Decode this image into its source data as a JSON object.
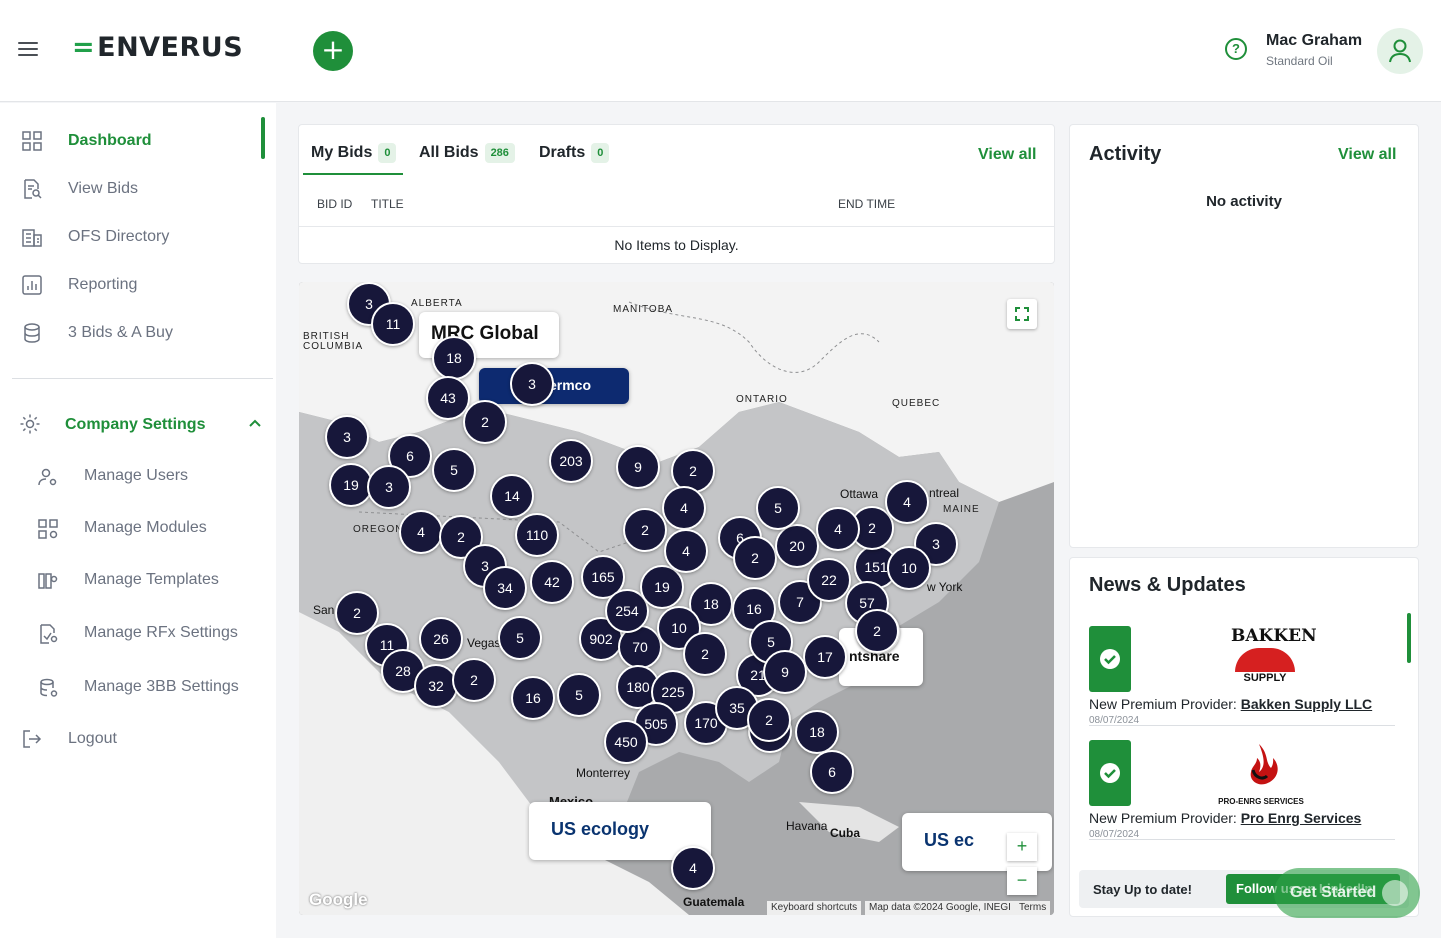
{
  "header": {
    "brand": "ENVERUS",
    "brand_mark": "=",
    "add_label": "+",
    "help_label": "?",
    "user_name": "Mac Graham",
    "user_org": "Standard Oil"
  },
  "sidebar": {
    "items": [
      {
        "label": "Dashboard",
        "icon": "grid-icon"
      },
      {
        "label": "View Bids",
        "icon": "document-search-icon"
      },
      {
        "label": "OFS Directory",
        "icon": "building-icon"
      },
      {
        "label": "Reporting",
        "icon": "bar-chart-icon"
      },
      {
        "label": "3 Bids & A Buy",
        "icon": "database-icon"
      }
    ],
    "company_settings": {
      "label": "Company Settings",
      "items": [
        {
          "label": "Manage Users"
        },
        {
          "label": "Manage Modules"
        },
        {
          "label": "Manage Templates"
        },
        {
          "label": "Manage RFx Settings"
        },
        {
          "label": "Manage 3BB Settings"
        }
      ]
    },
    "logout": "Logout"
  },
  "bids": {
    "tabs": [
      {
        "label": "My Bids",
        "count": "0"
      },
      {
        "label": "All Bids",
        "count": "286"
      },
      {
        "label": "Drafts",
        "count": "0"
      }
    ],
    "view_all": "View all",
    "columns": [
      "BID ID",
      "TITLE",
      "END TIME"
    ],
    "empty": "No Items to Display."
  },
  "map": {
    "clusters": [
      "3",
      "11",
      "18",
      "43",
      "3",
      "2",
      "3",
      "6",
      "5",
      "19",
      "3",
      "14",
      "203",
      "9",
      "2",
      "4",
      "2",
      "110",
      "4",
      "2",
      "3",
      "34",
      "42",
      "165",
      "2",
      "11",
      "26",
      "5",
      "28",
      "32",
      "2",
      "16",
      "5",
      "902",
      "70",
      "254",
      "19",
      "18",
      "16",
      "7",
      "10",
      "4",
      "6",
      "2",
      "20",
      "22",
      "151",
      "57",
      "13",
      "2",
      "4",
      "5",
      "4",
      "3",
      "10",
      "2",
      "21",
      "180",
      "225",
      "170",
      "505",
      "450",
      "24",
      "35",
      "2",
      "18",
      "6",
      "4",
      "17",
      "5",
      "9",
      "2"
    ],
    "labels": {
      "alberta": "ALBERTA",
      "manitoba": "MANITOBA",
      "bc": "BRITISH COLUMBIA",
      "ontario": "ONTARIO",
      "quebec": "QUEBEC",
      "oregon": "OREGON",
      "maine": "MAINE",
      "ottawa": "Ottawa",
      "montreal": "ntreal",
      "newyork": "w York",
      "monterrey": "Monterrey",
      "mexico": "Mexico",
      "havana": "Havana",
      "cuba": "Cuba",
      "guatemala": "Guatemala",
      "vegas": "Vegas",
      "san": "San"
    },
    "promos": {
      "mrc": "MRC Global",
      "ermco": "ermco",
      "usecology": "US ecology",
      "usecology2": "US ec",
      "ntshare": "ntshare"
    },
    "zoom_in": "+",
    "zoom_out": "−",
    "google": "Google",
    "shortcuts": "Keyboard shortcuts",
    "map_data": "Map data ©2024 Google, INEGI",
    "terms": "Terms"
  },
  "activity": {
    "title": "Activity",
    "view_all": "View all",
    "empty": "No activity"
  },
  "news": {
    "title": "News & Updates",
    "items": [
      {
        "prefix": "New Premium Provider: ",
        "name": "Bakken Supply LLC",
        "date": "08/07/2024",
        "logo_top": "BAKKEN",
        "logo_bottom": "SUPPLY"
      },
      {
        "prefix": "New Premium Provider: ",
        "name": "Pro Enrg Services",
        "date": "08/07/2024",
        "logo_bottom": "PRO-ENRG SERVICES"
      }
    ],
    "stay": "Stay Up to date!",
    "follow": "Follow us on LinkedIn"
  },
  "get_started": "Get Started",
  "colors": {
    "accent": "#1f8f3a",
    "cluster": "#17173a"
  }
}
